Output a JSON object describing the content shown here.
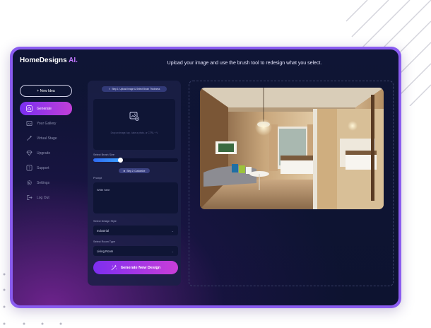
{
  "app": {
    "logo_text": "HomeDesigns",
    "logo_accent": "AI.",
    "tagline": "Upload your image and use the brush tool to redesign what you select."
  },
  "sidebar": {
    "new_idea_label": "+ New Idea",
    "items": [
      {
        "label": "Generate",
        "icon": "home-icon",
        "active": true
      },
      {
        "label": "Your Gallery",
        "icon": "gallery-icon",
        "active": false
      },
      {
        "label": "Virtual Stage",
        "icon": "wand-icon",
        "active": false
      },
      {
        "label": "Upgrade",
        "icon": "diamond-icon",
        "active": false
      },
      {
        "label": "Support",
        "icon": "help-icon",
        "active": false
      },
      {
        "label": "Settings",
        "icon": "gear-icon",
        "active": false
      },
      {
        "label": "Log Out",
        "icon": "logout-icon",
        "active": false
      }
    ]
  },
  "panel": {
    "step1_label": "Step 1: Upload Image & Select Brush Thickness",
    "upload_hint": "Drop an image, tap , take a photo, or CTRL + V",
    "brush_size_label": "Select Brush Size",
    "brush_size_value": 0.32,
    "step2_label": "Step 2: Customize",
    "prompt_label": "Prompt",
    "prompt_placeholder": "Write here",
    "design_style_label": "Select Design Style",
    "design_style_value": "Industrial",
    "room_type_label": "Select Room Type",
    "room_type_value": "Living Room",
    "generate_label": "Generate New Design"
  },
  "colors": {
    "accent_purple": "#8a5cf0",
    "gradient_start": "#7a2ff0",
    "gradient_end": "#c93ed8",
    "background": "#0f1535",
    "brush_fill": "#2f6bf2"
  }
}
